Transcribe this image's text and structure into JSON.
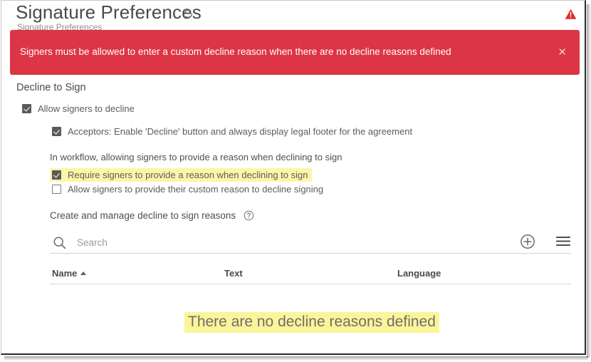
{
  "header": {
    "title": "Signature Preferences",
    "refresh_icon": "refresh-icon",
    "warning_icon": "warning-triangle-icon",
    "clipped_text": "Signature Preferences"
  },
  "banner": {
    "message": "Signers must be allowed to enter a custom decline reason when there are no decline reasons defined",
    "close_label": "✕",
    "background_color": "#dc3545",
    "text_color": "#ffffff"
  },
  "decline_section": {
    "title": "Decline to Sign",
    "options": [
      {
        "label": "Allow signers to decline",
        "checked": true,
        "highlighted": false
      },
      {
        "label": "Acceptors: Enable 'Decline' button and always display legal footer for the agreement",
        "checked": true,
        "highlighted": false
      }
    ],
    "workflow_note": "In workflow, allowing signers to provide a reason when declining to sign",
    "workflow_options": [
      {
        "label": "Require signers to provide a reason when declining to sign",
        "checked": true,
        "highlighted": true
      },
      {
        "label": "Allow signers to provide their custom reason to decline signing",
        "checked": false,
        "highlighted": false
      }
    ],
    "manage_label": "Create and manage decline to sign reasons",
    "help_icon": "help-circle-icon"
  },
  "toolbar": {
    "search_placeholder": "Search",
    "search_value": "",
    "search_icon": "search-icon",
    "add_icon": "add-circle-icon",
    "menu_icon": "hamburger-menu-icon"
  },
  "table": {
    "columns": [
      {
        "label": "Name",
        "sorted": "asc"
      },
      {
        "label": "Text",
        "sorted": "none"
      },
      {
        "label": "Language",
        "sorted": "none"
      }
    ],
    "rows": [],
    "empty_message": "There are no decline reasons defined"
  },
  "colors": {
    "highlight": "#fbf59a",
    "danger": "#dc3545",
    "text": "#4f4f4f"
  }
}
